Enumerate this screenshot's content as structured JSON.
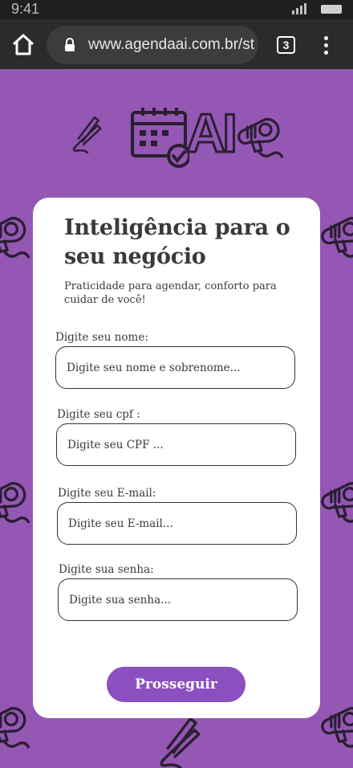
{
  "status_bar": {
    "time": "9:41"
  },
  "browser": {
    "url": "www.agendaai.com.br/st",
    "tab_count": "3"
  },
  "logo": {
    "text": "AI"
  },
  "form": {
    "title": "Inteligência para o seu negócio",
    "subtitle": "Praticidade para agendar, conforto para cuidar de você!",
    "fields": [
      {
        "label": "Digite seu nome:",
        "placeholder": "Digite seu nome e sobrenome..."
      },
      {
        "label": "Digite seu cpf :",
        "placeholder": "Digite seu CPF ..."
      },
      {
        "label": "Digite seu E-mail:",
        "placeholder": "Digite seu E-mail..."
      },
      {
        "label": "Digite sua senha:",
        "placeholder": "Digite sua senha..."
      }
    ],
    "submit_label": "Prosseguir"
  },
  "colors": {
    "background": "#9457b3",
    "card": "#ffffff",
    "button": "#8b4fbf",
    "icon_stroke": "#2a1f33",
    "browser_bar": "#2b2b2b"
  }
}
